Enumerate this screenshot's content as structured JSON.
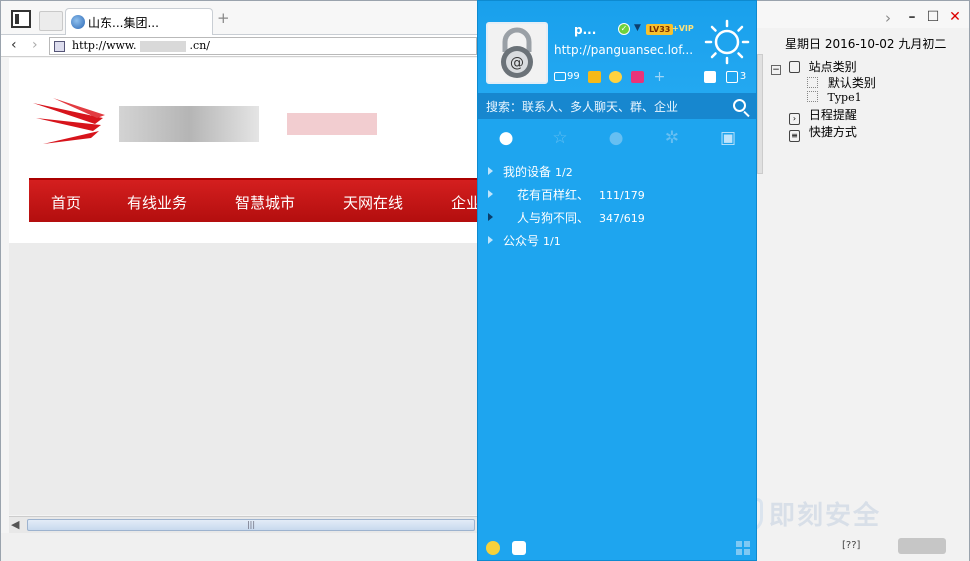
{
  "browser": {
    "tab_title": "山东...集团...",
    "new_tab": "+",
    "url": "http://www.",
    "url_suffix": ".cn/"
  },
  "website": {
    "nav": [
      "首页",
      "有线业务",
      "智慧城市",
      "天网在线",
      "企业"
    ],
    "brand_color": "#c8141a"
  },
  "calendar": {
    "date": "星期日 2016-10-02 九月初二",
    "tree": {
      "root": "站点类别",
      "children": [
        "默认类别",
        "Type1"
      ],
      "schedule": "日程提醒",
      "shortcuts": "快捷方式"
    },
    "watermark": "即刻安全",
    "corner_text": "[??]"
  },
  "qq": {
    "nickname": "p...",
    "level": "LV33",
    "vip": "VIP",
    "signature": "http://panguansec.lof...",
    "mail_count": "99",
    "message_count": "3",
    "search_placeholder": "搜索：联系人、多人聊天、群、企业",
    "groups": [
      {
        "name": "我的设备",
        "count": "1/2"
      },
      {
        "name": "花有百样红、",
        "count": "111/179"
      },
      {
        "name": "人与狗不同、",
        "count": "347/619"
      },
      {
        "name": "公众号",
        "count": "1/1"
      }
    ],
    "panel_color": "#1ea5ef"
  }
}
